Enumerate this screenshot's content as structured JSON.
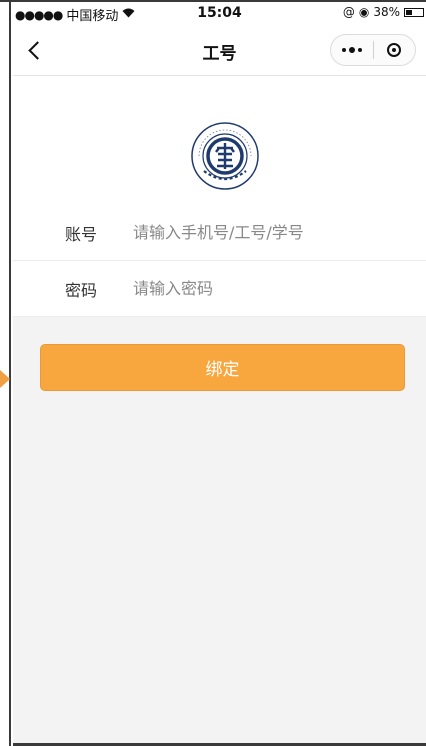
{
  "status_bar": {
    "signal": "●●●●●",
    "carrier": "中国移动",
    "wifi_icon": "wifi-icon",
    "time": "15:04",
    "lock_icon": "@",
    "alarm_icon": "◉",
    "battery": "38%",
    "battery_level": 0.38
  },
  "nav": {
    "back_icon": "chevron-left-icon",
    "title": "工号",
    "more_icon": "more-dots-icon",
    "close_icon": "target-close-icon"
  },
  "form": {
    "account_label": "账号",
    "account_placeholder": "请输入手机号/工号/学号",
    "account_value": "",
    "password_label": "密码",
    "password_placeholder": "请输入密码",
    "password_value": ""
  },
  "actions": {
    "bind_label": "绑定"
  },
  "colors": {
    "accent": "#f8a73e",
    "logo_blue": "#1f3b6e",
    "background": "#f3f3f3"
  }
}
